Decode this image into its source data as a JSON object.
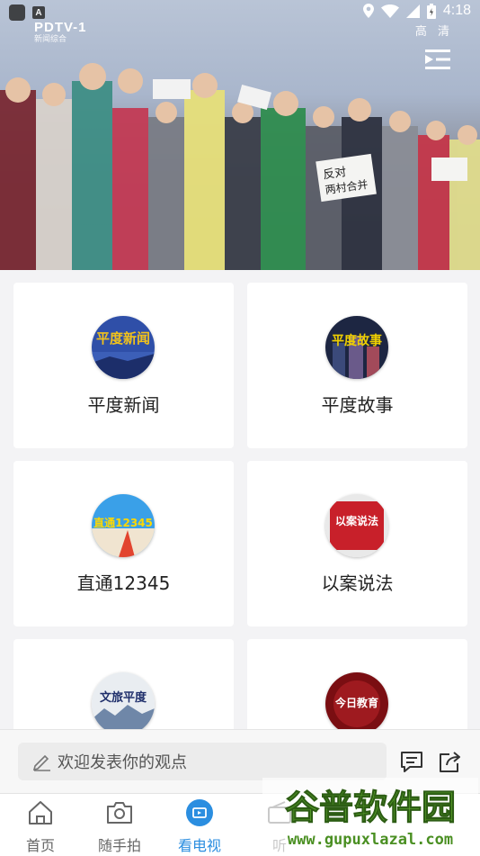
{
  "status_bar": {
    "time": "4:18",
    "a_badge": "A"
  },
  "video": {
    "channel_name": "PDTV-1",
    "channel_sub": "新闻综合",
    "quality": "高 清",
    "signs": [
      "反对",
      "两村合并"
    ]
  },
  "programs": [
    {
      "label": "平度新闻",
      "logo_text": "平度新闻",
      "logo_colors": [
        "#2f4fa8",
        "#f2c21b"
      ]
    },
    {
      "label": "平度故事",
      "logo_text": "平度故事",
      "logo_colors": [
        "#1d2642",
        "#f0d000"
      ]
    },
    {
      "label": "直通12345",
      "logo_text": "直通12345",
      "logo_colors": [
        "#3aa0e8",
        "#ffd800"
      ]
    },
    {
      "label": "以案说法",
      "logo_text": "以案说法",
      "logo_colors": [
        "#c8202a",
        "#ffffff"
      ]
    },
    {
      "label": "文旅平度",
      "logo_text": "文旅平度",
      "logo_colors": [
        "#e9edf1",
        "#1f2f6b"
      ]
    },
    {
      "label": "今日教育",
      "logo_text": "今日教育",
      "logo_colors": [
        "#7a0e12",
        "#ffffff"
      ]
    }
  ],
  "comment": {
    "placeholder": "欢迎发表你的观点"
  },
  "tabs": [
    {
      "label": "首页",
      "icon": "home-icon",
      "active": false
    },
    {
      "label": "随手拍",
      "icon": "camera-icon",
      "active": false
    },
    {
      "label": "看电视",
      "icon": "tv-icon",
      "active": true
    },
    {
      "label": "听",
      "icon": "radio-icon",
      "active": false
    }
  ],
  "watermark": {
    "title": "谷普软件园",
    "url": "www.gupuxlazal.com"
  },
  "colors": {
    "accent": "#2b8ee0",
    "background": "#f3f3f5"
  }
}
